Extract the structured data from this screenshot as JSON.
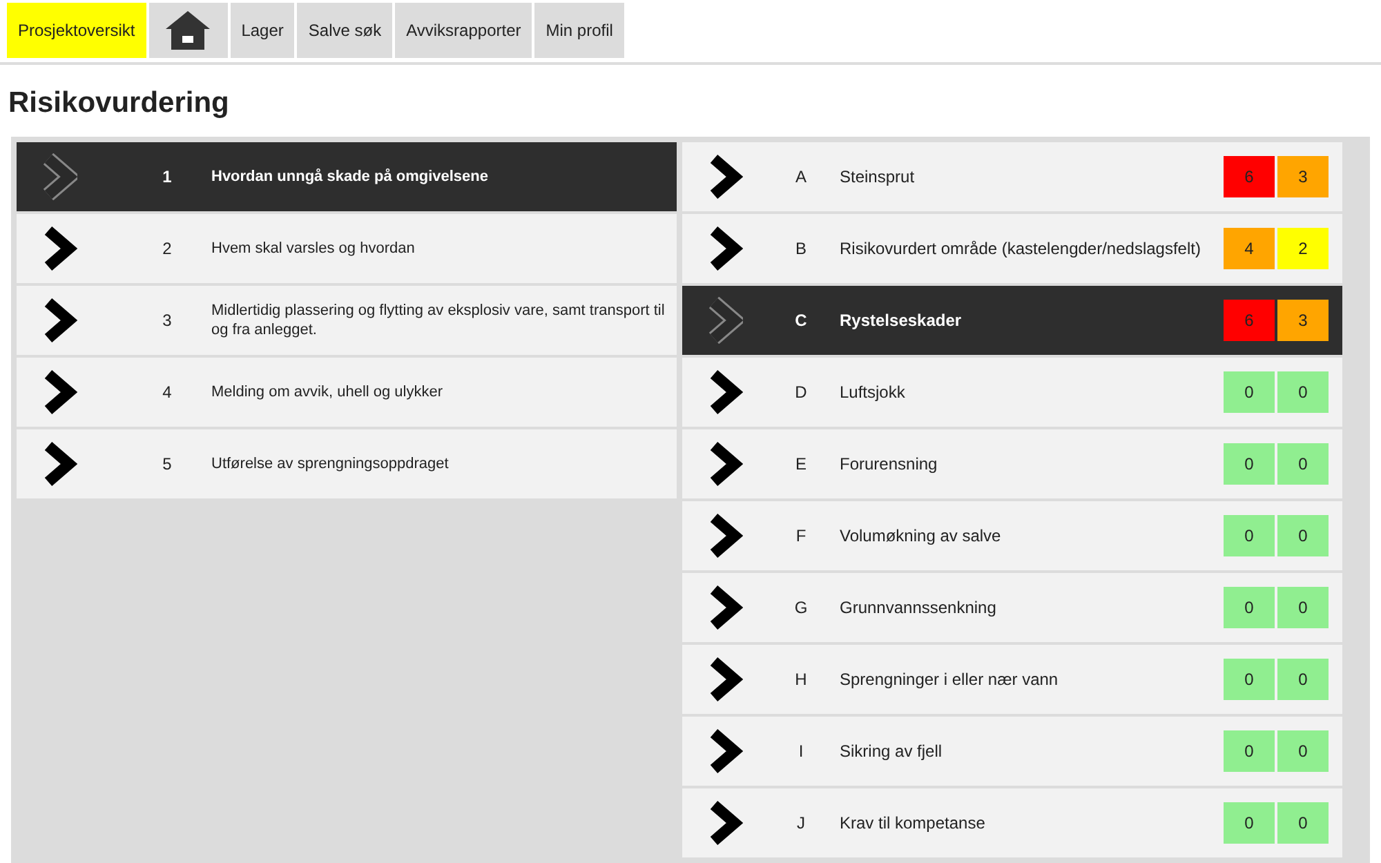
{
  "nav": [
    {
      "kind": "text",
      "label": "Prosjektoversikt",
      "selected": true
    },
    {
      "kind": "home",
      "selected": false
    },
    {
      "kind": "text",
      "label": "Lager",
      "selected": false
    },
    {
      "kind": "text",
      "label": "Salve søk",
      "selected": false
    },
    {
      "kind": "text",
      "label": "Avviksrapporter",
      "selected": false
    },
    {
      "kind": "text",
      "label": "Min profil",
      "selected": false
    }
  ],
  "title": "Risikovurdering",
  "categories": [
    {
      "number": "1",
      "label": "Hvordan unngå skade på omgivelsene",
      "selected": true
    },
    {
      "number": "2",
      "label": "Hvem skal varsles og hvordan",
      "selected": false
    },
    {
      "number": "3",
      "label": "Midlertidig plassering og flytting av eksplosiv vare, samt transport til og fra anlegget.",
      "selected": false
    },
    {
      "number": "4",
      "label": "Melding om avvik, uhell og ulykker",
      "selected": false
    },
    {
      "number": "5",
      "label": "Utførelse av sprengningsoppdraget",
      "selected": false
    }
  ],
  "risks": [
    {
      "letter": "A",
      "label": "Steinsprut",
      "selected": false,
      "scores": [
        {
          "value": "6",
          "color": "#ff0000"
        },
        {
          "value": "3",
          "color": "#ffa500"
        }
      ]
    },
    {
      "letter": "B",
      "label": "Risikovurdert område (kastelengder/nedslagsfelt)",
      "selected": false,
      "scores": [
        {
          "value": "4",
          "color": "#ffa500"
        },
        {
          "value": "2",
          "color": "#ffff00"
        }
      ]
    },
    {
      "letter": "C",
      "label": "Rystelseskader",
      "selected": true,
      "scores": [
        {
          "value": "6",
          "color": "#ff0000"
        },
        {
          "value": "3",
          "color": "#ffa500"
        }
      ]
    },
    {
      "letter": "D",
      "label": "Luftsjokk",
      "selected": false,
      "scores": [
        {
          "value": "0",
          "color": "#90ee90"
        },
        {
          "value": "0",
          "color": "#90ee90"
        }
      ]
    },
    {
      "letter": "E",
      "label": "Forurensning",
      "selected": false,
      "scores": [
        {
          "value": "0",
          "color": "#90ee90"
        },
        {
          "value": "0",
          "color": "#90ee90"
        }
      ]
    },
    {
      "letter": "F",
      "label": "Volumøkning av salve",
      "selected": false,
      "scores": [
        {
          "value": "0",
          "color": "#90ee90"
        },
        {
          "value": "0",
          "color": "#90ee90"
        }
      ]
    },
    {
      "letter": "G",
      "label": "Grunnvannssenkning",
      "selected": false,
      "scores": [
        {
          "value": "0",
          "color": "#90ee90"
        },
        {
          "value": "0",
          "color": "#90ee90"
        }
      ]
    },
    {
      "letter": "H",
      "label": "Sprengninger i eller nær vann",
      "selected": false,
      "scores": [
        {
          "value": "0",
          "color": "#90ee90"
        },
        {
          "value": "0",
          "color": "#90ee90"
        }
      ]
    },
    {
      "letter": "I",
      "label": "Sikring av fjell",
      "selected": false,
      "scores": [
        {
          "value": "0",
          "color": "#90ee90"
        },
        {
          "value": "0",
          "color": "#90ee90"
        }
      ]
    },
    {
      "letter": "J",
      "label": "Krav til kompetanse",
      "selected": false,
      "scores": [
        {
          "value": "0",
          "color": "#90ee90"
        },
        {
          "value": "0",
          "color": "#90ee90"
        }
      ]
    }
  ]
}
